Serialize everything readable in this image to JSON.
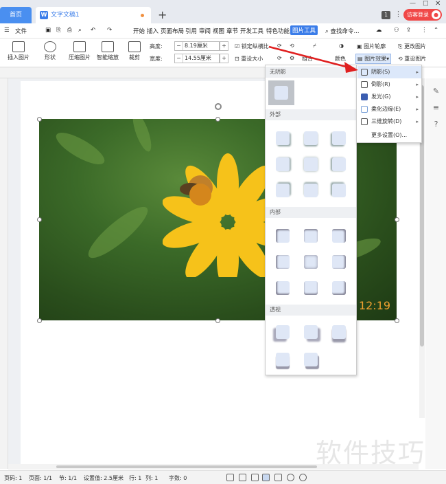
{
  "tabs": {
    "home": "首页",
    "doc": "文字文稿1",
    "new": "+",
    "count_badge": "1",
    "login": "访客登录"
  },
  "menu": {
    "file": "文件",
    "items": [
      "开始",
      "插入",
      "页面布局",
      "引用",
      "审阅",
      "视图",
      "章节",
      "开发工具",
      "特色功能"
    ],
    "active": "图片工具",
    "search": "查找命令..."
  },
  "ribbon": {
    "insert_pic": "插入图片",
    "shape": "形状",
    "compress": "压缩图片",
    "smart_zoom": "智能缩放",
    "crop": "裁剪",
    "height_label": "高度:",
    "height_val": "8.19厘米",
    "width_label": "宽度:",
    "width_val": "14.55厘米",
    "lock_ratio": "锁定纵横比",
    "reset_size": "重设大小",
    "pic_contour": "图片轮廓",
    "change_pic": "更改图片",
    "pic_effect": "图片效果",
    "reset_pic": "重设图片",
    "color": "颜色",
    "combine": "组合"
  },
  "dropdown": {
    "no_shadow": "无阴影",
    "outer": "外部",
    "inner": "内部",
    "perspective": "透视"
  },
  "submenu": {
    "items": [
      "阴影(S)",
      "倒影(R)",
      "发光(G)",
      "柔化边缘(E)",
      "三维旋转(D)",
      "更多设置(O)..."
    ]
  },
  "photo": {
    "timestamp": "12:19"
  },
  "status": {
    "page": "页码: 1",
    "pages": "页面: 1/1",
    "section": "节: 1/1",
    "setting": "设置值: 2.5厘米",
    "row": "行: 1",
    "col": "列: 1",
    "chars": "字数: 0"
  },
  "watermark": "软件技巧"
}
